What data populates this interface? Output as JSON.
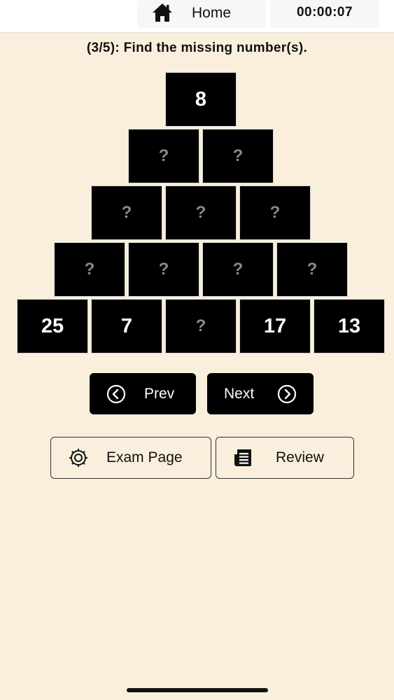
{
  "header": {
    "home_label": "Home",
    "timer": "00:00:07"
  },
  "question": {
    "text": "(3/5): Find the missing number(s)."
  },
  "pyramid": {
    "rows": [
      [
        "8"
      ],
      [
        "?",
        "?"
      ],
      [
        "?",
        "?",
        "?"
      ],
      [
        "?",
        "?",
        "?",
        "?"
      ],
      [
        "25",
        "7",
        "?",
        "17",
        "13"
      ]
    ]
  },
  "nav": {
    "prev_label": "Prev",
    "next_label": "Next"
  },
  "actions": {
    "exam_page_label": "Exam Page",
    "review_label": "Review"
  },
  "icons": {
    "home": "home-icon",
    "prev": "chevron-left-circle-icon",
    "next": "chevron-right-circle-icon",
    "exam": "gear-icon",
    "review": "document-list-icon"
  },
  "colors": {
    "background": "#f9efdc",
    "cell": "#000000",
    "missing_text": "#8a8a8a"
  }
}
